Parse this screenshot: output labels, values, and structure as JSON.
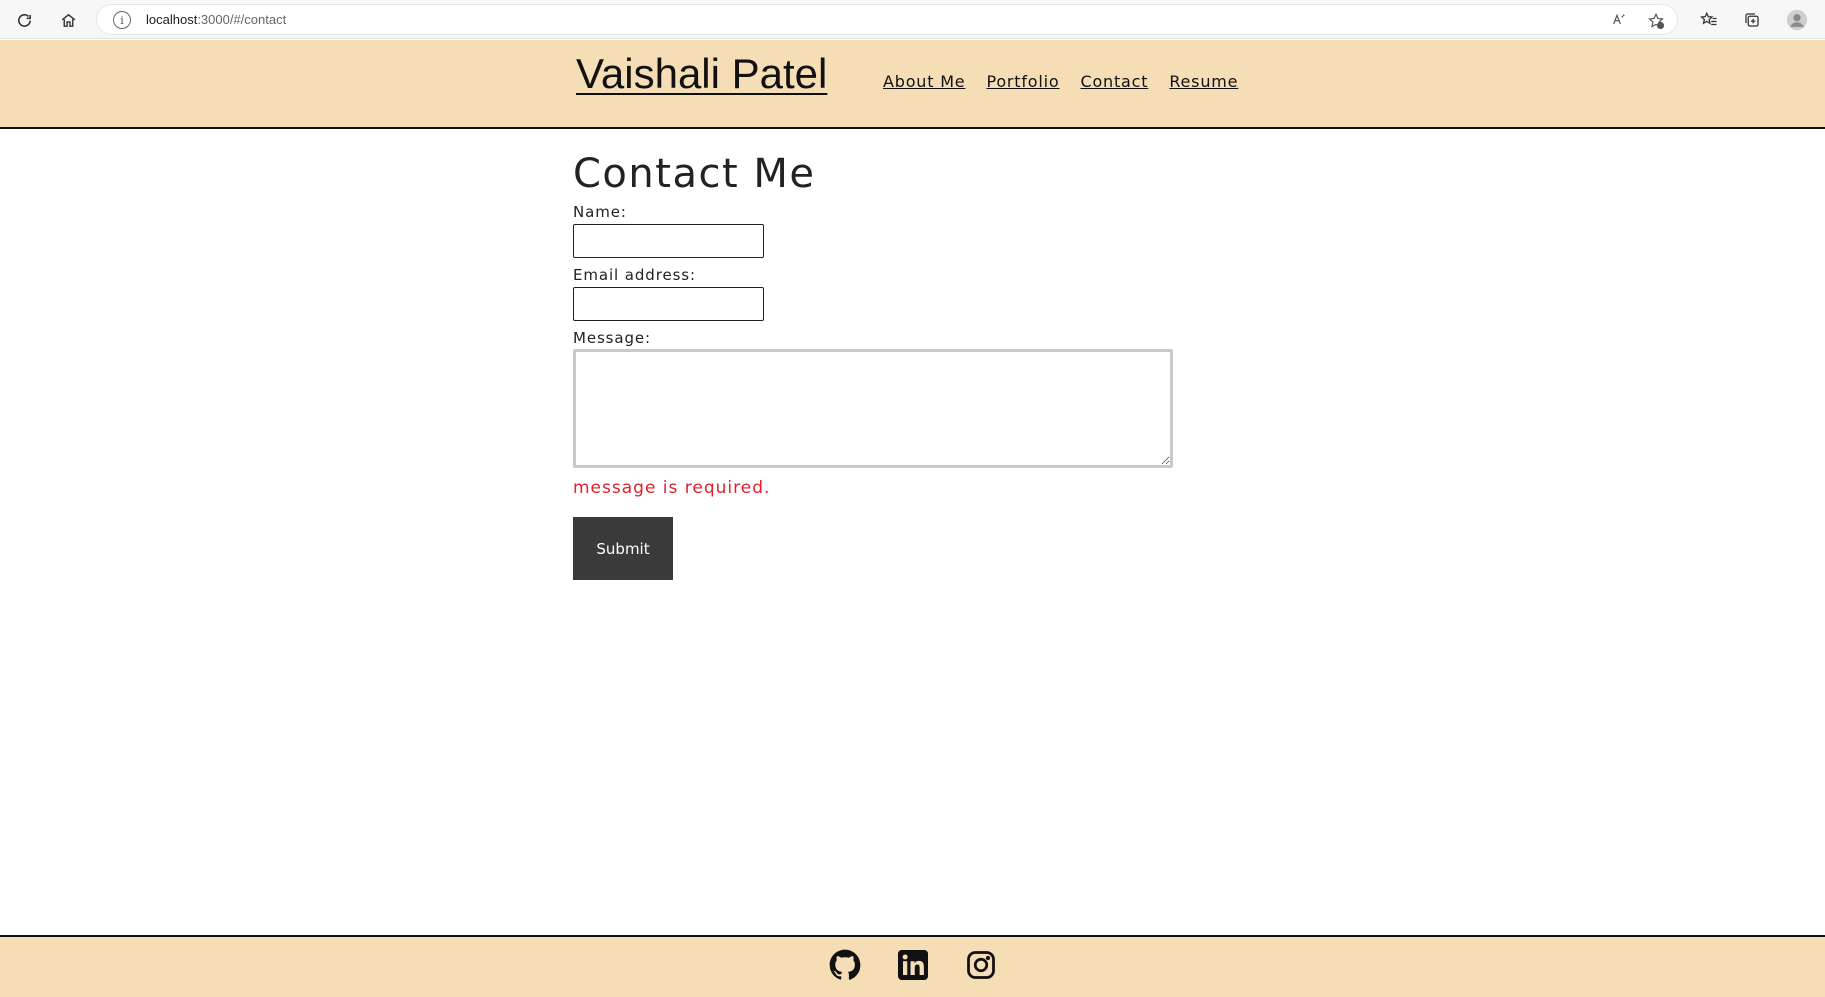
{
  "browser": {
    "url_host": "localhost",
    "url_rest": ":3000/#/contact"
  },
  "header": {
    "brand": "Vaishali Patel",
    "nav": [
      "About Me",
      "Portfolio",
      "Contact",
      "Resume"
    ]
  },
  "contact_form": {
    "title": "Contact Me",
    "name_label": "Name:",
    "email_label": "Email address:",
    "message_label": "Message:",
    "name_value": "",
    "email_value": "",
    "message_value": "",
    "error": "message is required.",
    "submit_label": "Submit"
  },
  "footer": {
    "icons": [
      "github-icon",
      "linkedin-icon",
      "instagram-icon"
    ]
  },
  "colors": {
    "header_bg": "#f5ddb5",
    "error": "#e0202d",
    "button_bg": "#3a3a3a"
  }
}
